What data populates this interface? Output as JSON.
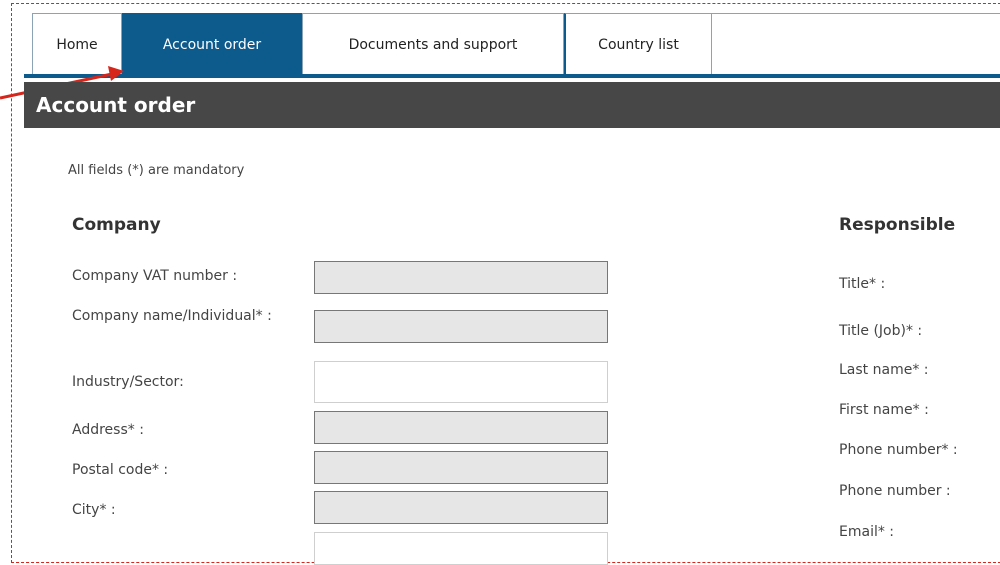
{
  "tabs": [
    {
      "id": "home",
      "label": "Home",
      "active": false
    },
    {
      "id": "account-order",
      "label": "Account order",
      "active": true
    },
    {
      "id": "documents",
      "label": "Documents and support",
      "active": false
    },
    {
      "id": "country-list",
      "label": "Country list",
      "active": false
    }
  ],
  "page": {
    "title": "Account order",
    "mandatory_note": "All fields (*) are mandatory"
  },
  "company": {
    "heading": "Company",
    "fields": [
      {
        "label": "Company VAT number :",
        "value": ""
      },
      {
        "label": "Company name/Individual* :",
        "value": ""
      },
      {
        "label": "Industry/Sector:",
        "value": ""
      },
      {
        "label": "Address* :",
        "value": ""
      },
      {
        "label": "Postal code* :",
        "value": ""
      },
      {
        "label": "City* :",
        "value": ""
      }
    ]
  },
  "responsible": {
    "heading": "Responsible",
    "fields": [
      {
        "label": "Title* :"
      },
      {
        "label": "Title (Job)* :"
      },
      {
        "label": "Last name* :"
      },
      {
        "label": "First name* :"
      },
      {
        "label": "Phone number* :"
      },
      {
        "label": "Phone number :"
      },
      {
        "label": "Email* :"
      }
    ]
  },
  "colors": {
    "tab_active": "#0d5a8c",
    "title_bar": "#474747",
    "annotation": "#d6261c"
  }
}
